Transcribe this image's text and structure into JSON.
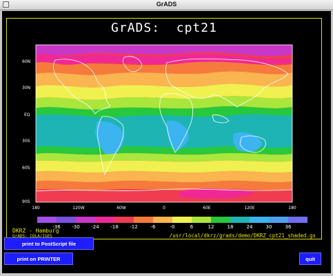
{
  "window": {
    "title": "GrADS"
  },
  "plot": {
    "title": "GrADS:  cpt21",
    "lat_labels": [
      "60N",
      "30N",
      "EQ",
      "30S",
      "60S",
      "90S"
    ],
    "lon_labels": [
      "180",
      "120W",
      "60W",
      "0",
      "60E",
      "120E",
      "180"
    ],
    "colorbar": {
      "labels": [
        "-36",
        "-30",
        "-24",
        "-18",
        "-12",
        "-6",
        "-0",
        "6",
        "12",
        "18",
        "24",
        "30",
        "36"
      ],
      "colors": [
        "#a050e6",
        "#7a50e0",
        "#c837c8",
        "#f02896",
        "#f03c50",
        "#f57a3c",
        "#fab450",
        "#f0f050",
        "#aae63c",
        "#28c83c",
        "#1eb4b4",
        "#3cb4f0",
        "#50a0f0",
        "#6e6ef0"
      ]
    },
    "footer_left_line1": "DKRZ - Hamburg",
    "footer_left_line2": "GrADS: COLA/IGES",
    "footer_right": "/usr/local/dkrz/grads/demo/DKRZ_cpt21_shaded.gs"
  },
  "buttons": {
    "print_postscript": "print to PostScript file",
    "print_printer": "print on PRINTER",
    "quit": "quit"
  }
}
